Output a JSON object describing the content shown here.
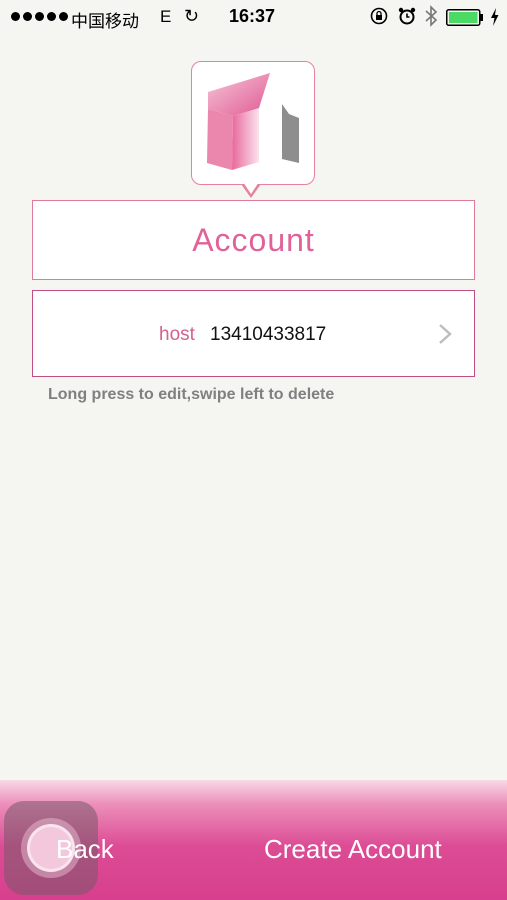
{
  "status_bar": {
    "carrier": "中国移动",
    "network": "E",
    "sync_icon": "↻",
    "time": "16:37",
    "icons": [
      "rotation-lock-icon",
      "alarm-icon",
      "bluetooth-icon",
      "battery-icon",
      "charging-icon"
    ],
    "battery_color": "#4cd964"
  },
  "header": {
    "title": "Account"
  },
  "accounts": [
    {
      "label": "host",
      "value": "13410433817"
    }
  ],
  "hint": "Long press to edit,swipe left to delete",
  "bottom_bar": {
    "back_label": "Back",
    "create_label": "Create Account"
  },
  "colors": {
    "accent": "#e0629a",
    "background": "#f5f5f1",
    "bar": "#d73f8d"
  }
}
